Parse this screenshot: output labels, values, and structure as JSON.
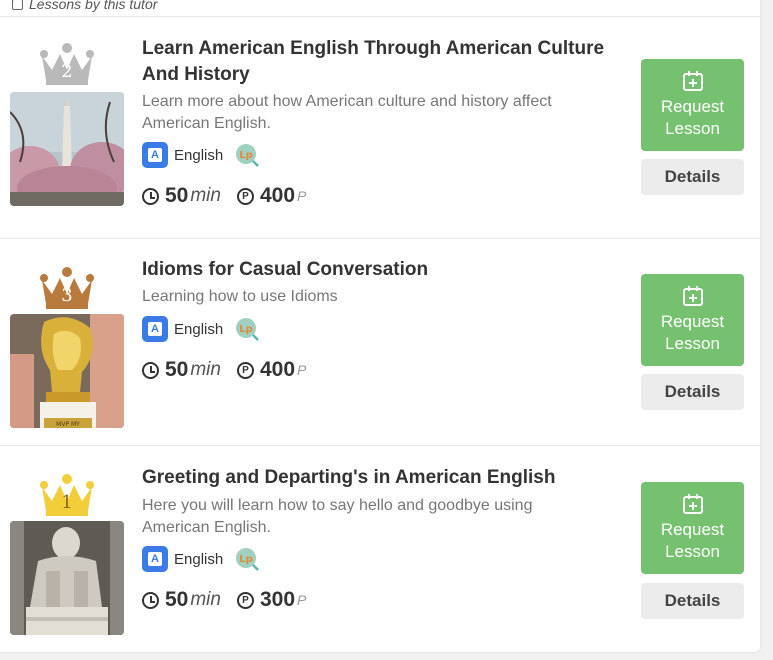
{
  "section": {
    "title": "Lessons by this tutor"
  },
  "lessons": [
    {
      "rank": "2",
      "rank_color": "#b9b9b9",
      "title_line1": "Learn American English Through American Culture",
      "title_line2": "And History",
      "desc_line1": "Learn more about how American culture and history affect",
      "desc_line2": "American English.",
      "language": "English",
      "duration": "50",
      "duration_unit": "min",
      "points": "400",
      "points_unit": "P",
      "request_line1": "Request",
      "request_line2": "Lesson",
      "details_label": "Details",
      "thumb_icon": "washington-monument-photo"
    },
    {
      "rank": "3",
      "rank_color": "#b87a3d",
      "title_line1": "Idioms for Casual Conversation",
      "title_line2": "",
      "desc_line1": "Learning how to use Idioms",
      "desc_line2": "",
      "language": "English",
      "duration": "50",
      "duration_unit": "min",
      "points": "400",
      "points_unit": "P",
      "request_line1": "Request",
      "request_line2": "Lesson",
      "details_label": "Details",
      "thumb_icon": "trophy-photo",
      "thumb_caption": "MVP MY"
    },
    {
      "rank": "1",
      "rank_color": "#f2cf3a",
      "title_line1": "Greeting and Departing's in American English",
      "title_line2": "",
      "desc_line1": "Here you will learn how to say hello and goodbye using",
      "desc_line2": "American English.",
      "language": "English",
      "duration": "50",
      "duration_unit": "min",
      "points": "300",
      "points_unit": "P",
      "request_line1": "Request",
      "request_line2": "Lesson",
      "details_label": "Details",
      "thumb_icon": "lincoln-memorial-photo"
    }
  ],
  "colors": {
    "accent_green": "#76c16f",
    "language_blue": "#3a7be5",
    "details_bg": "#ececec"
  }
}
